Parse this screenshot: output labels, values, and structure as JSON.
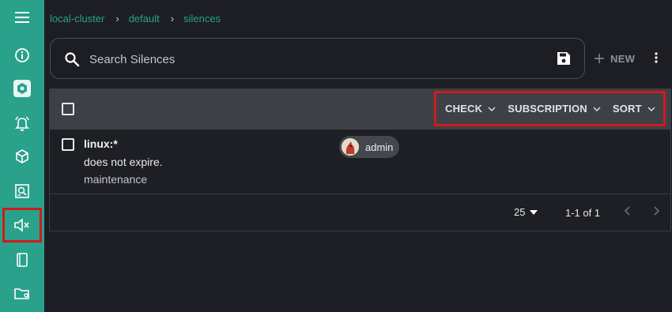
{
  "breadcrumb": {
    "items": [
      "local-cluster",
      "default",
      "silences"
    ],
    "separator": "›"
  },
  "search": {
    "placeholder": "Search Silences",
    "value": ""
  },
  "toolbar": {
    "new_label": "NEW"
  },
  "sidebar": {
    "items": [
      {
        "name": "menu-icon"
      },
      {
        "name": "info-icon"
      },
      {
        "name": "hexagon-icon"
      },
      {
        "name": "bell-icon"
      },
      {
        "name": "cube-icon"
      },
      {
        "name": "report-icon"
      },
      {
        "name": "speaker-mute-icon",
        "active": true
      },
      {
        "name": "document-icon"
      },
      {
        "name": "folder-settings-icon"
      }
    ]
  },
  "list": {
    "filters": [
      "CHECK",
      "SUBSCRIPTION",
      "SORT"
    ],
    "rows": [
      {
        "title": "linux:*",
        "description": "does not expire.",
        "tag": "maintenance",
        "creator": "admin"
      }
    ],
    "pagination": {
      "per_page": "25",
      "range": "1-1 of 1"
    }
  },
  "colors": {
    "sidebar": "#2aa18a",
    "accent": "#27a38b",
    "highlight": "#cf1b1b",
    "background": "#1d1e24",
    "header": "#3e4047"
  }
}
